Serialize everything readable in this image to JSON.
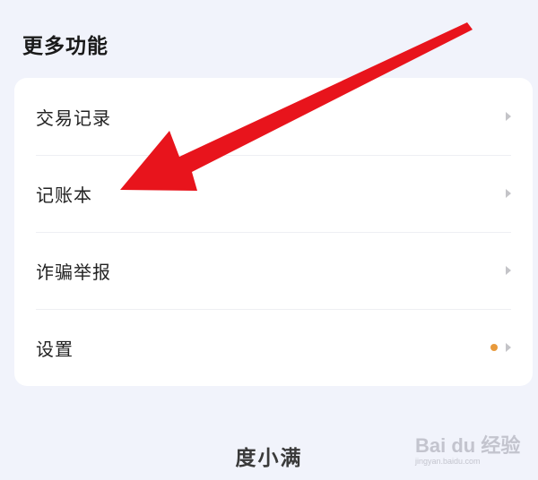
{
  "section": {
    "title": "更多功能"
  },
  "menu": {
    "items": [
      {
        "label": "交易记录"
      },
      {
        "label": "记账本"
      },
      {
        "label": "诈骗举报"
      },
      {
        "label": "设置",
        "badge_color": "#e89a3c"
      }
    ]
  },
  "footer": {
    "brand": "度小满"
  },
  "annotation": {
    "arrow_color": "#e8141c"
  },
  "watermark": {
    "logo": "Bai du 经验",
    "url": "jingyan.baidu.com"
  }
}
